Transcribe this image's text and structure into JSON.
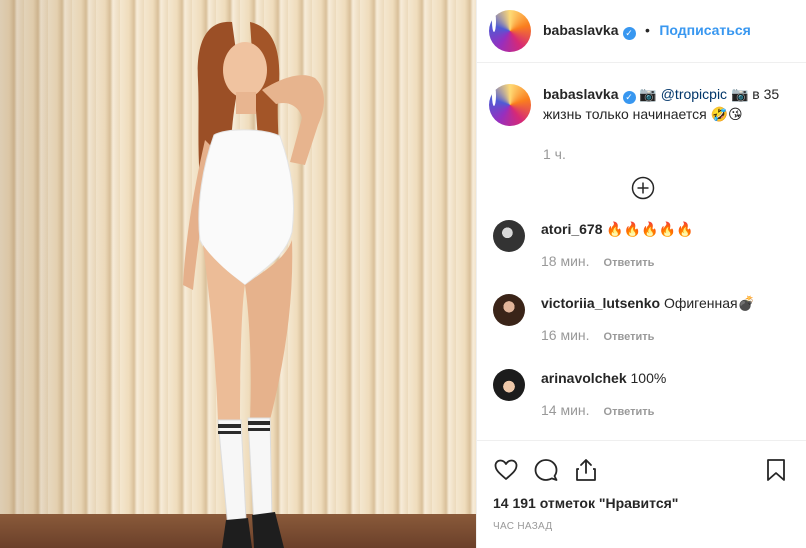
{
  "post": {
    "username": "babaslavka",
    "follow_label": "Подписаться",
    "caption_camera1": "📷",
    "caption_mention": "@tropicpic",
    "caption_camera2": "📷",
    "caption_text": "в 35 жизнь только начинается 🤣😘",
    "caption_time": "1 ч."
  },
  "comments": [
    {
      "username": "atori_678",
      "text": "🔥🔥🔥🔥🔥",
      "time": "18 мин.",
      "reply_label": "Ответить"
    },
    {
      "username": "victoriia_lutsenko",
      "text": "Офигенная💣",
      "time": "16 мин.",
      "reply_label": "Ответить"
    },
    {
      "username": "arinavolchek",
      "text": "100%",
      "time": "14 мин.",
      "reply_label": "Ответить"
    }
  ],
  "footer": {
    "likes": "14 191 отметок \"Нравится\"",
    "posted": "ЧАС НАЗАД"
  },
  "icons": {
    "like": "heart-icon",
    "comment": "speech-bubble-icon",
    "share": "share-icon",
    "save": "bookmark-icon",
    "load_more": "plus-circle-icon"
  },
  "colors": {
    "link_blue": "#3897f0",
    "mention_blue": "#003569",
    "muted": "#999999"
  }
}
